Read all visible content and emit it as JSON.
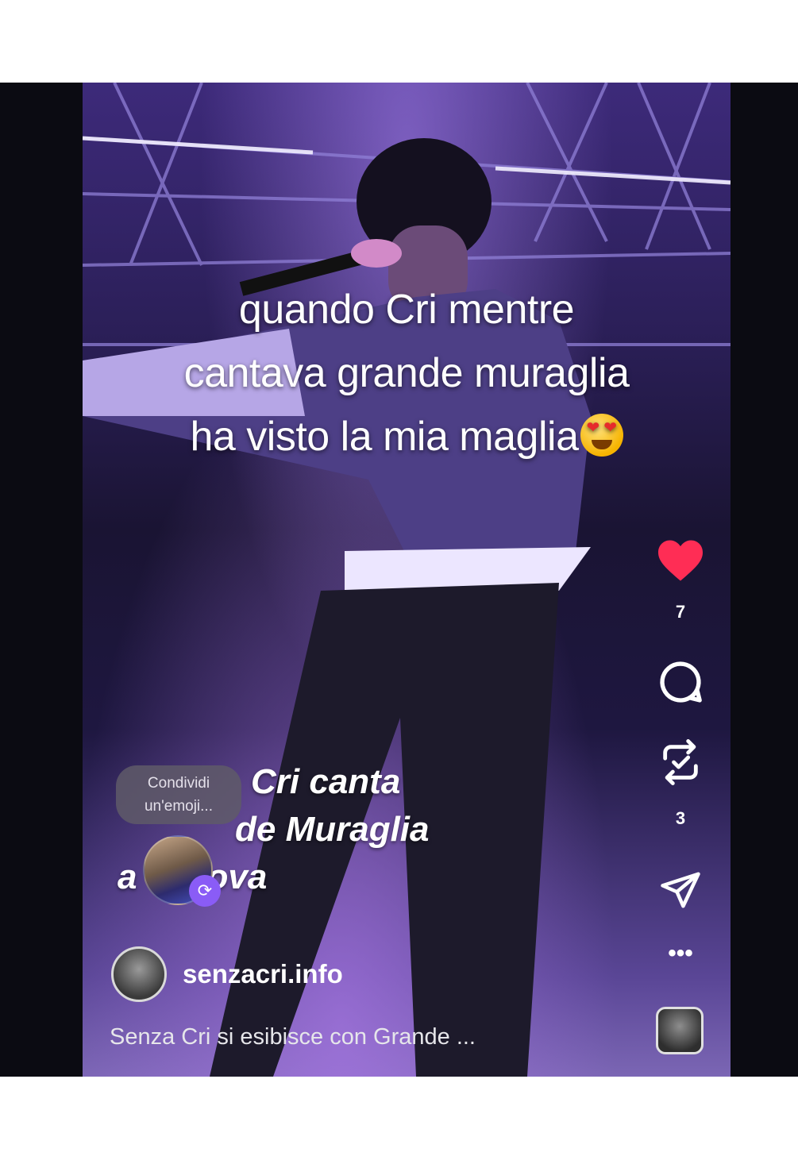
{
  "overlay": {
    "line1": "quando Cri mentre",
    "line2": "cantava grande muraglia",
    "line3": "ha visto la mia maglia",
    "emoji_icon": "heart-eyes-emoji"
  },
  "video_title": {
    "line1": "Cri canta",
    "line2": "de Muraglia",
    "line3": "a     nova"
  },
  "emoji_prompt": {
    "label": "Condividi un'emoji..."
  },
  "post": {
    "username": "senzacri.info",
    "caption": "Senza Cri si esibisce con Grande ..."
  },
  "actions": {
    "like_count": "7",
    "repost_count": "3",
    "icons": [
      "heart-icon",
      "comment-icon",
      "repost-icon",
      "send-icon",
      "more-icon",
      "audio-thumbnail"
    ]
  },
  "colors": {
    "like": "#ff2d55",
    "repost_badge": "#8a5cf6"
  }
}
